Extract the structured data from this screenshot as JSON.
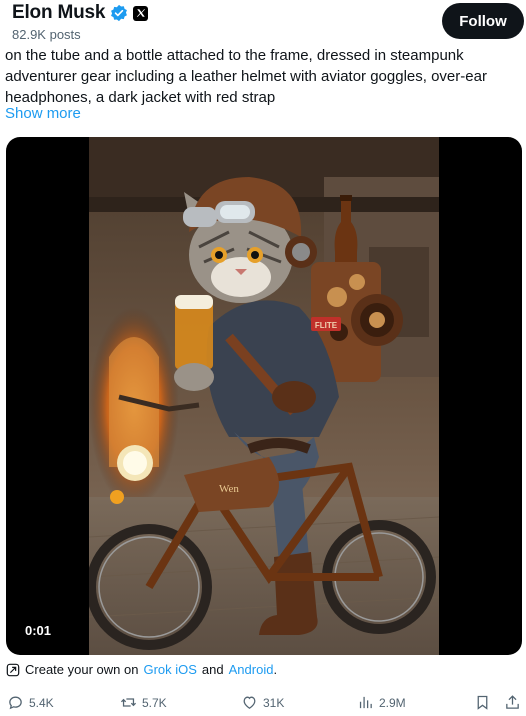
{
  "header": {
    "name": "Elon Musk",
    "posts": "82.9K posts",
    "follow_label": "Follow"
  },
  "post": {
    "text": "on the tube and a bottle attached to the frame, dressed in steampunk adventurer gear including a leather helmet with aviator goggles, over-ear headphones, a dark jacket with red strap",
    "show_more": "Show more"
  },
  "media": {
    "duration": "0:01",
    "jacket_patch": "FLITE",
    "frame_badge": "Wen"
  },
  "grok": {
    "prefix": "Create your own on",
    "link_ios": "Grok iOS",
    "and": "and",
    "link_android": "Android",
    "suffix": "."
  },
  "actions": {
    "replies": "5.4K",
    "reposts": "5.7K",
    "likes": "31K",
    "views": "2.9M"
  },
  "icons": {
    "verified": "verified-badge-icon",
    "x_logo": "x-logo-icon",
    "reply": "reply-icon",
    "repost": "repost-icon",
    "like": "heart-icon",
    "views": "views-icon",
    "bookmark": "bookmark-icon",
    "share": "share-icon",
    "grok": "grok-icon"
  },
  "colors": {
    "accent": "#1d9bf0",
    "text": "#0f1419",
    "muted": "#536471"
  }
}
